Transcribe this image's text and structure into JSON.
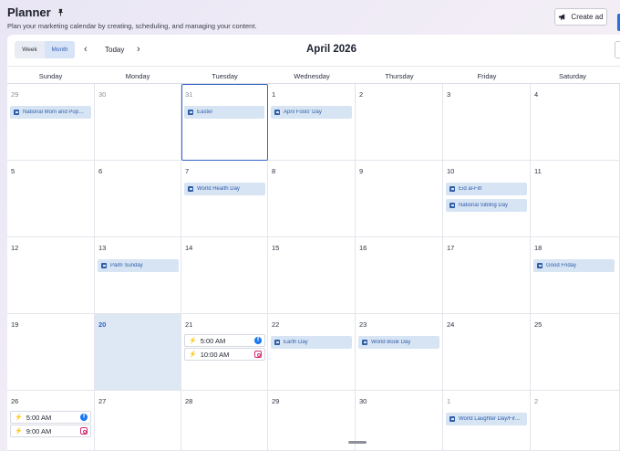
{
  "header": {
    "title": "Planner",
    "subtitle": "Plan your marketing calendar by creating, scheduling, and managing your content.",
    "create_label": "Create ad"
  },
  "toolbar": {
    "view_week": "Week",
    "view_month": "Month",
    "today_label": "Today",
    "month_title": "April 2026",
    "prev_icon": "chevron-left",
    "next_icon": "chevron-right"
  },
  "weekdays": [
    "Sunday",
    "Monday",
    "Tuesday",
    "Wednesday",
    "Thursday",
    "Friday",
    "Saturday"
  ],
  "weeks": [
    {
      "days": [
        "29",
        "30",
        "31",
        "1",
        "2",
        "3",
        "4"
      ]
    },
    {
      "days": [
        "5",
        "6",
        "7",
        "8",
        "9",
        "10",
        "11"
      ]
    },
    {
      "days": [
        "12",
        "13",
        "14",
        "15",
        "16",
        "17",
        "18"
      ]
    },
    {
      "days": [
        "19",
        "20",
        "21",
        "22",
        "23",
        "24",
        "25"
      ]
    },
    {
      "days": [
        "26",
        "27",
        "28",
        "29",
        "30",
        "1",
        "2"
      ]
    }
  ],
  "events": {
    "w0": [
      "National Mom and Pop…",
      "Easter",
      "April Fools' Day"
    ],
    "w1": [
      "World Health Day",
      "Eid al-Fitr",
      "National Sibling Day"
    ],
    "w2": [
      "Palm Sunday",
      "Good Friday"
    ],
    "w3": [
      "Earth Day",
      "World Book Day"
    ],
    "w4": [
      "World Laughter Day/Fir…"
    ]
  },
  "posts": {
    "w3_tue": [
      {
        "time": "5:00 AM",
        "network": "facebook-icon"
      },
      {
        "time": "10:00 AM",
        "network": "instagram-icon"
      }
    ],
    "w4_sun": [
      {
        "time": "5:00 AM",
        "network": "facebook-icon"
      },
      {
        "time": "9:00 AM",
        "network": "instagram-icon"
      }
    ]
  },
  "colors": {
    "accent": "#2f64c2",
    "event_bg": "#d7e4f4",
    "today_bg": "#dde8f4",
    "facebook": "#1877f2",
    "instagram": "#d62976"
  }
}
